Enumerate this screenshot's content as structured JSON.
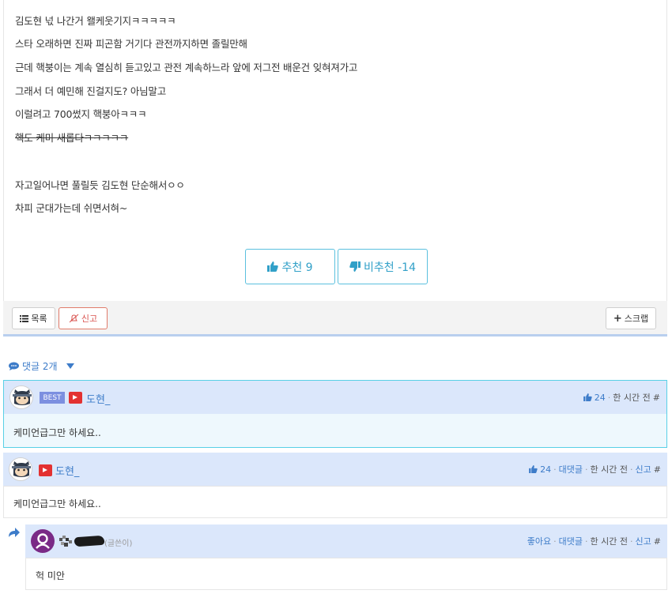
{
  "post": {
    "lines": [
      "김도현 넋 나간거 왤케웃기지ㅋㅋㅋㅋㅋ",
      "스타 오래하면 진짜 피곤함 거기다 관전까지하면 졸릴만해",
      "근데 핵붕이는 계속 열심히 듣고있고 관전 계속하느라 앞에 저그전 배운건 잊혀져가고",
      "그래서 더 예민해 진걸지도? 아님말고",
      "이럴려고 700썼지 핵붕아ㅋㅋㅋ",
      "핵도 케미 새롭다ㅋㅋㅋㅋㅋ",
      "자고일어나면 풀릴듯 김도현 단순해서ㅇㅇ",
      "차피 군대가는데 쉬면서혀~"
    ],
    "upvote_label": "추천 9",
    "downvote_label": "비추천 -14"
  },
  "toolbar": {
    "list_label": "목록",
    "report_label": "신고",
    "scrap_label": "스크랩"
  },
  "comments_header": {
    "label": "댓글 2개"
  },
  "comments": [
    {
      "badge": "BEST",
      "nick": "도현_",
      "likes": "24",
      "time": "한 시간 전",
      "hash": "#",
      "body": "케미언급그만 하세요.."
    },
    {
      "nick": "도현_",
      "likes": "24",
      "reply": "대댓글",
      "time": "한 시간 전",
      "report": "신고",
      "hash": "#",
      "body": "케미언급그만 하세요.."
    }
  ],
  "reply": {
    "author_tag": "(글쓴이)",
    "like": "좋아요",
    "reply": "대댓글",
    "time": "한 시간 전",
    "report": "신고",
    "hash": "#",
    "body": "헉 미안"
  },
  "colors": {
    "accent": "#3d7cc9",
    "vote_border": "#5bc0de",
    "comment_head_bg": "#dbe7fb",
    "best_border": "#58d0e6",
    "report_red": "#d9534f",
    "cam_red": "#e33131"
  }
}
